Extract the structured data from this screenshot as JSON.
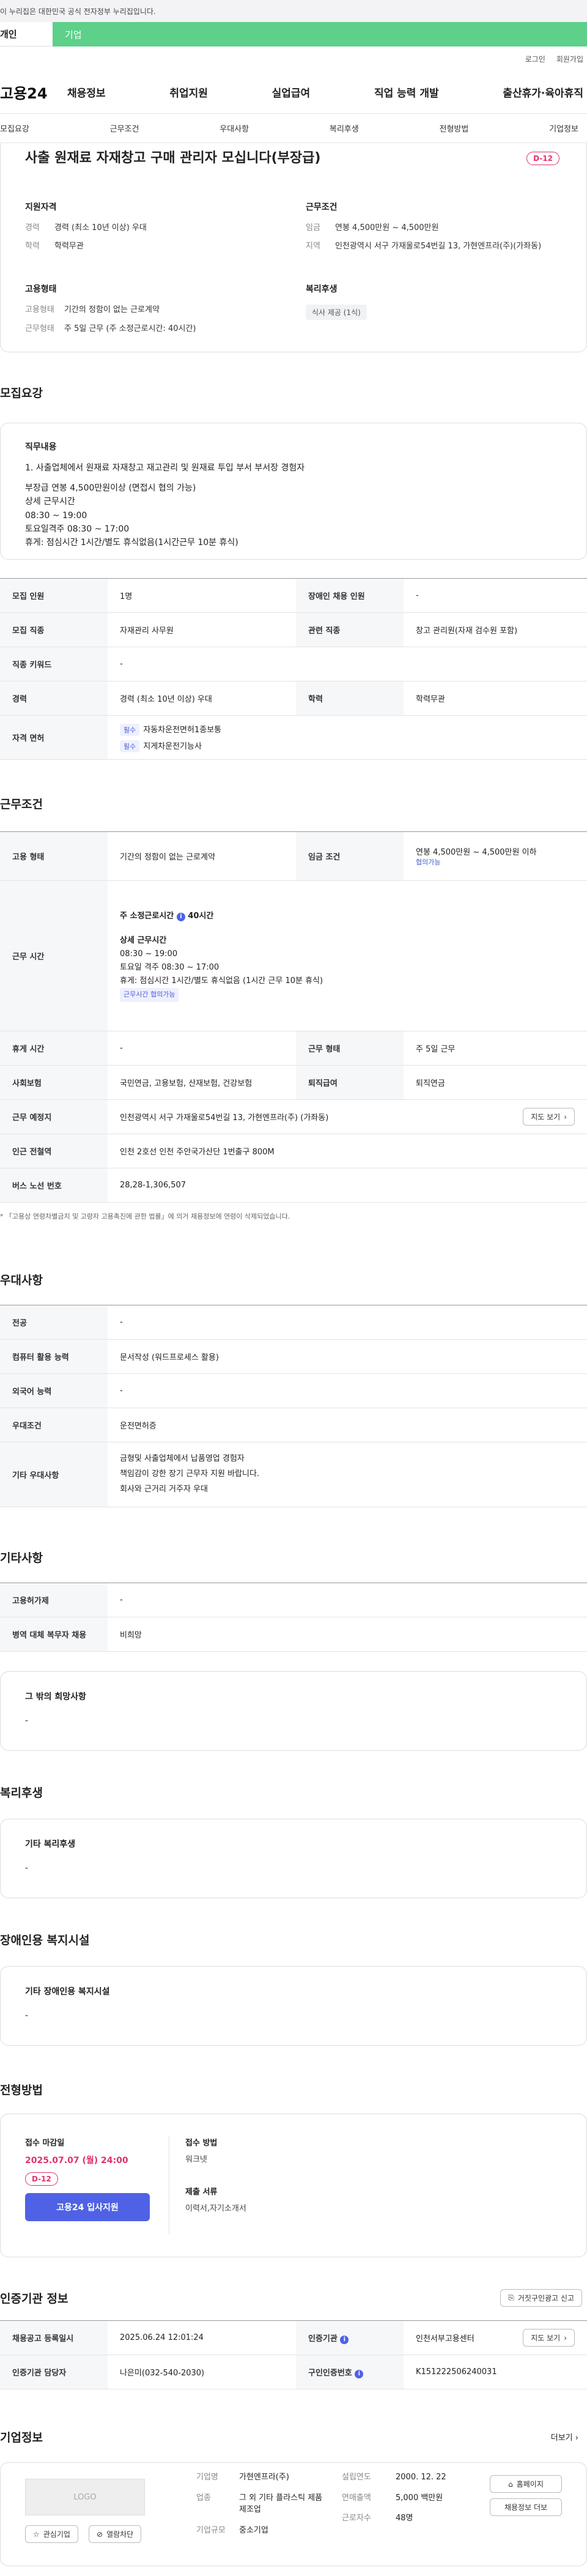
{
  "gov_notice": "이 누리집은 대한민국 공식 전자정부 누리집입니다.",
  "tabs": [
    "개인",
    "기업"
  ],
  "util": [
    "로그인",
    "회원가입"
  ],
  "logo": "고용24",
  "gnb": [
    "채용정보",
    "취업지원",
    "실업급여",
    "직업 능력 개발",
    "출산휴가·육아휴직"
  ],
  "lnb": [
    "모집요강",
    "근무조건",
    "우대사항",
    "복리후생",
    "전형방법",
    "기업정보"
  ],
  "hero": {
    "title": "사출 원재료 자재창고 구매 관리자 모십니다(부장급)",
    "dday": "D-12",
    "groups": [
      {
        "title": "지원자격",
        "rows": [
          {
            "k": "경력",
            "v": "경력 (최소 10년 이상) 우대"
          },
          {
            "k": "학력",
            "v": "학력무관"
          }
        ]
      },
      {
        "title": "근무조건",
        "rows": [
          {
            "k": "임금",
            "v": "연봉 4,500만원 ~ 4,500만원"
          },
          {
            "k": "지역",
            "v": "인천광역시 서구 가재울로54번길 13, 가현엔프라(주)(가좌동)"
          }
        ]
      },
      {
        "title": "고용형태",
        "rows": [
          {
            "k": "고용형태",
            "v": "기간의 정함이 없는 근로계약"
          },
          {
            "k": "근무형태",
            "v": "주 5일 근무 (주 소정근로시간: 40시간)"
          }
        ]
      },
      {
        "title": "복리후생",
        "chip": "식사 제공 (1식)"
      }
    ]
  },
  "recruit": {
    "title": "모집요강",
    "duty_label": "직무내용",
    "duty_lines": [
      "1. 사출업체에서 원재료 자재창고 재고관리 및 원재료 투입 부서 부서장 경험자",
      "부장급 연봉 4,500만원이상 (면접시 협의 가능)",
      "상세 근무시간",
      "08:30 ~ 19:00",
      "토요일격주 08:30 ~ 17:00",
      "휴게: 점심시간 1시간/별도 휴식없음(1시간근무 10분 휴식)"
    ],
    "rows": [
      {
        "k1": "모집 인원",
        "v1": "1명",
        "k2": "장애인 채용 인원",
        "v2": "-"
      },
      {
        "k1": "모집 직종",
        "v1": "자재관리 사무원",
        "k2": "관련 직종",
        "v2": "창고 관리원(자재 검수원 포함)"
      },
      {
        "k1": "직종 키워드",
        "v1": "-"
      },
      {
        "k1": "경력",
        "v1": "경력 (최소 10년 이상) 우대",
        "k2": "학력",
        "v2": "학력무관"
      }
    ],
    "license_label": "자격 면허",
    "licenses": [
      {
        "tag": "필수",
        "name": "자동차운전면허1종보통"
      },
      {
        "tag": "필수",
        "name": "지게차운전기능사"
      }
    ]
  },
  "work": {
    "title": "근무조건",
    "employ_k": "고용 형태",
    "employ_v": "기간의 정함이 없는 근로계약",
    "wage_k": "임금 조건",
    "wage_v": "연봉 4,500만원 ~ 4,500만원 이하",
    "wage_link": "협의가능",
    "time_k": "근무 시간",
    "time_week": "주 소정근로시간",
    "time_week_v": "40시간",
    "time_detail_label": "상세 근무시간",
    "time_lines": [
      "08:30 ~ 19:00",
      "토요일 격주 08:30 ~ 17:00",
      "휴게: 점심시간 1시간/별도 휴식없음 (1시간 근무 10분 휴식)"
    ],
    "time_tag": "근무시간 협의가능",
    "rows": [
      {
        "k1": "휴게 시간",
        "v1": "-",
        "k2": "근무 형태",
        "v2": "주 5일 근무"
      },
      {
        "k1": "사회보험",
        "v1": "국민연금, 고용보험, 산재보험, 건강보험",
        "k2": "퇴직급여",
        "v2": "퇴직연금"
      }
    ],
    "place_k": "근무 예정지",
    "place_v": "인천광역시 서구 가재울로54번길 13, 가현엔프라(주) (가좌동)",
    "map_btn": "지도 보기",
    "subway_k": "인근 전철역",
    "subway_v": "인천 2호선 인천 주안국가산단 1번출구 800M",
    "bus_k": "버스 노선 번호",
    "bus_v": "28,28-1,306,507",
    "note": "* 「고용상 연령차별금지 및 고령자 고용촉진에 관한 법률」에 의거 채용정보에 연령이 삭제되었습니다."
  },
  "pref": {
    "title": "우대사항",
    "rows": [
      {
        "k": "전공",
        "v": "-"
      },
      {
        "k": "컴퓨터 활용 능력",
        "v": "문서작성 (워드프로세스 활용)"
      },
      {
        "k": "외국어 능력",
        "v": "-"
      },
      {
        "k": "우대조건",
        "v": "운전면허증"
      }
    ],
    "etc_k": "기타 우대사항",
    "etc_lines": [
      "금형및 사출업체에서 납품영업 경험자",
      "책임감이 강한 장기 근무자 지원 바랍니다.",
      "회사와 근거리 거주자 우대"
    ]
  },
  "other": {
    "title": "기타사항",
    "rows": [
      {
        "k": "고용허가제",
        "v": "-"
      },
      {
        "k": "병역 대체 복무자 채용",
        "v": "비희망"
      }
    ],
    "box_label": "그 밖의 희망사항",
    "box_value": "-"
  },
  "welfare": {
    "title": "복리후생",
    "box_label": "기타 복리후생",
    "box_value": "-"
  },
  "disab": {
    "title": "장애인용 복지시설",
    "box_label": "기타 장애인용 복지시설",
    "box_value": "-"
  },
  "process": {
    "title": "전형방법",
    "deadline_label": "접수 마감일",
    "deadline": "2025.07.07 (월) 24:00",
    "dday": "D-12",
    "apply_btn": "고용24 입사지원",
    "method_label": "접수 방법",
    "method": "워크넷",
    "docs_label": "제출 서류",
    "docs": "이력서,자기소개서"
  },
  "agency": {
    "title": "인증기관 정보",
    "report_btn": "거짓구인광고 신고",
    "rows": [
      {
        "k1": "채용공고 등록일시",
        "v1": "2025.06.24 12:01:24",
        "k2": "인증기관",
        "v2": "인천서부고용센터",
        "btn": "지도 보기"
      },
      {
        "k1": "인증기관 담당자",
        "v1": "나은미(032-540-2030)",
        "k2": "구인인증번호",
        "v2": "K151222506240031"
      }
    ]
  },
  "company": {
    "title": "기업정보",
    "more": "더보기",
    "logo": "LOGO",
    "fav_btn": "관심기업",
    "reject_btn": "열람차단",
    "rows": [
      {
        "k": "기업명",
        "v": "가현엔프라(주)"
      },
      {
        "k": "업종",
        "v": "그 외 기타 플라스틱 제품 제조업"
      },
      {
        "k": "기업규모",
        "v": "중소기업"
      }
    ],
    "rows2": [
      {
        "k": "설립연도",
        "v": "2000. 12. 22"
      },
      {
        "k": "연매출액",
        "v": "5,000 백만원"
      },
      {
        "k": "근로자수",
        "v": "48명"
      }
    ],
    "home_btn": "홈페이지",
    "jobs_btn": "채용정보 더보"
  }
}
